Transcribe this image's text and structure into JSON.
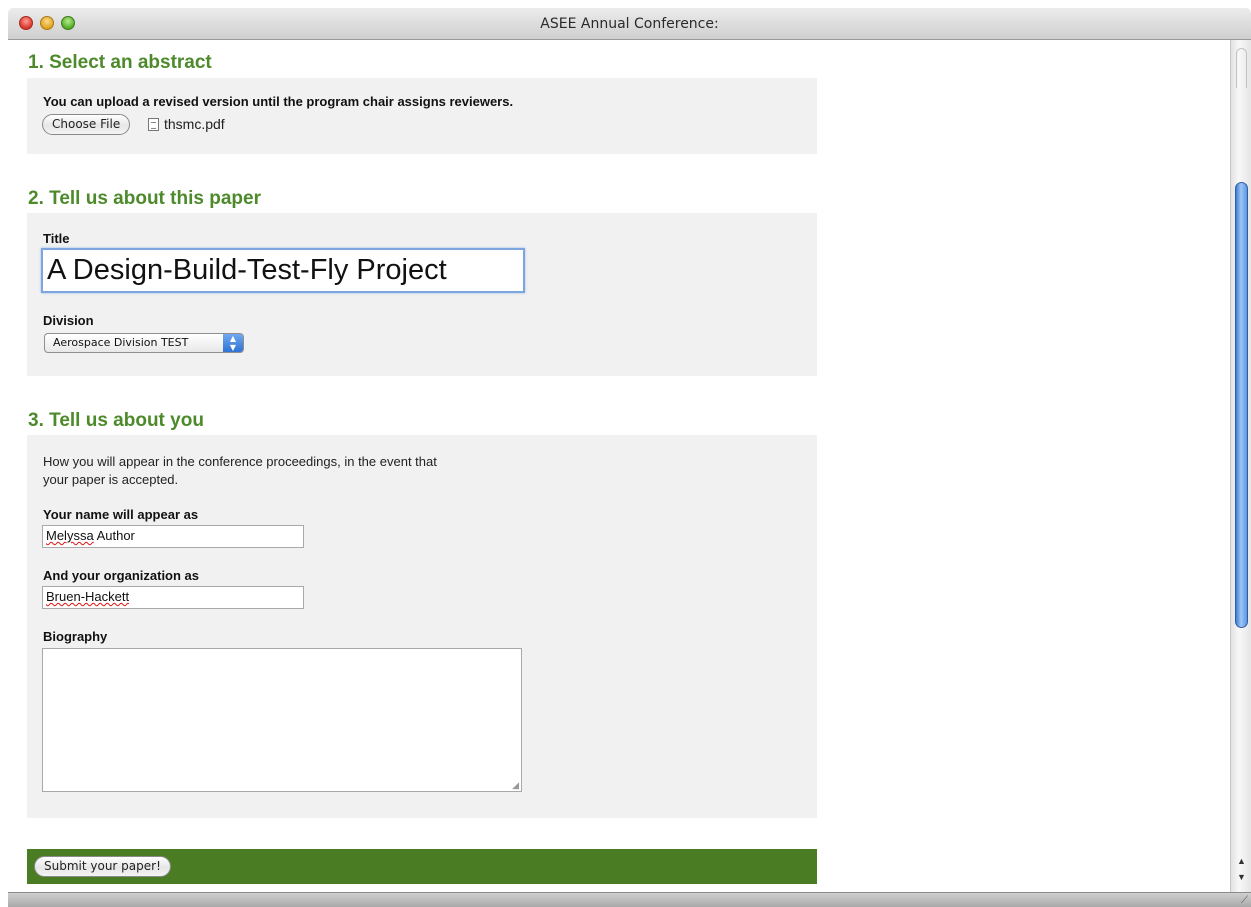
{
  "window": {
    "title": "ASEE Annual Conference:"
  },
  "section1": {
    "heading": "1. Select an abstract",
    "instructions": "You can upload a revised version until the program chair assigns reviewers.",
    "choose_file_label": "Choose File",
    "file_name": "thsmc.pdf"
  },
  "section2": {
    "heading": "2. Tell us about this paper",
    "title_label": "Title",
    "title_value": "A Design-Build-Test-Fly Project",
    "division_label": "Division",
    "division_value": "Aerospace Division TEST"
  },
  "section3": {
    "heading": "3. Tell us about you",
    "intro_line1": "How you will appear in the conference proceedings, in the event that",
    "intro_line2": "your paper is accepted.",
    "name_label": "Your name will appear as",
    "name_first": "Melyssa",
    "name_last": " Author",
    "org_label": "And your organization as",
    "org_value": "Bruen-Hackett",
    "bio_label": "Biography",
    "bio_value": ""
  },
  "submit": {
    "label": "Submit your paper!"
  },
  "colors": {
    "heading_green": "#4d8a2b",
    "submit_bar_green": "#4a7d23",
    "panel_gray": "#f1f1f1",
    "focus_blue": "#7ea6de"
  }
}
